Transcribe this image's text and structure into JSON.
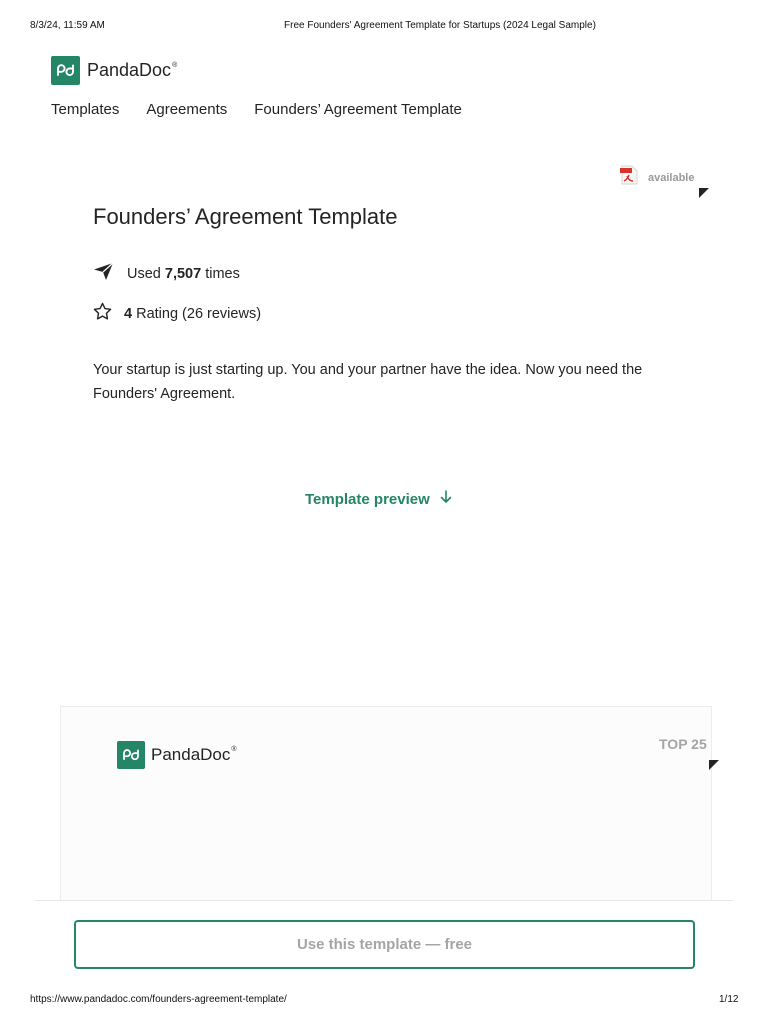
{
  "print_header": {
    "datetime": "8/3/24, 11:59 AM",
    "doc_title": "Free Founders' Agreement Template for Startups (2024 Legal Sample)"
  },
  "brand": {
    "name": "PandaDoc",
    "mark": "®",
    "color": "#248567"
  },
  "breadcrumb": [
    "Templates",
    "Agreements",
    "Founders’ Agreement Template"
  ],
  "badge": {
    "icon": "pdf-icon",
    "label": "available"
  },
  "template": {
    "title": "Founders’ Agreement Template",
    "usage": {
      "prefix": "Used",
      "count": "7,507",
      "suffix": "times"
    },
    "rating": {
      "value": "4",
      "text": "Rating (26 reviews)"
    },
    "description": "Your startup is just starting up. You and your partner have the idea. Now you need the Founders' Agreement."
  },
  "preview": {
    "label": "Template preview",
    "icon": "arrow-down-icon"
  },
  "card": {
    "brand": "PandaDoc",
    "badge": "TOP 25"
  },
  "cta": {
    "label": "Use this template — free"
  },
  "print_footer": {
    "url": "https://www.pandadoc.com/founders-agreement-template/",
    "page": "1/12"
  }
}
